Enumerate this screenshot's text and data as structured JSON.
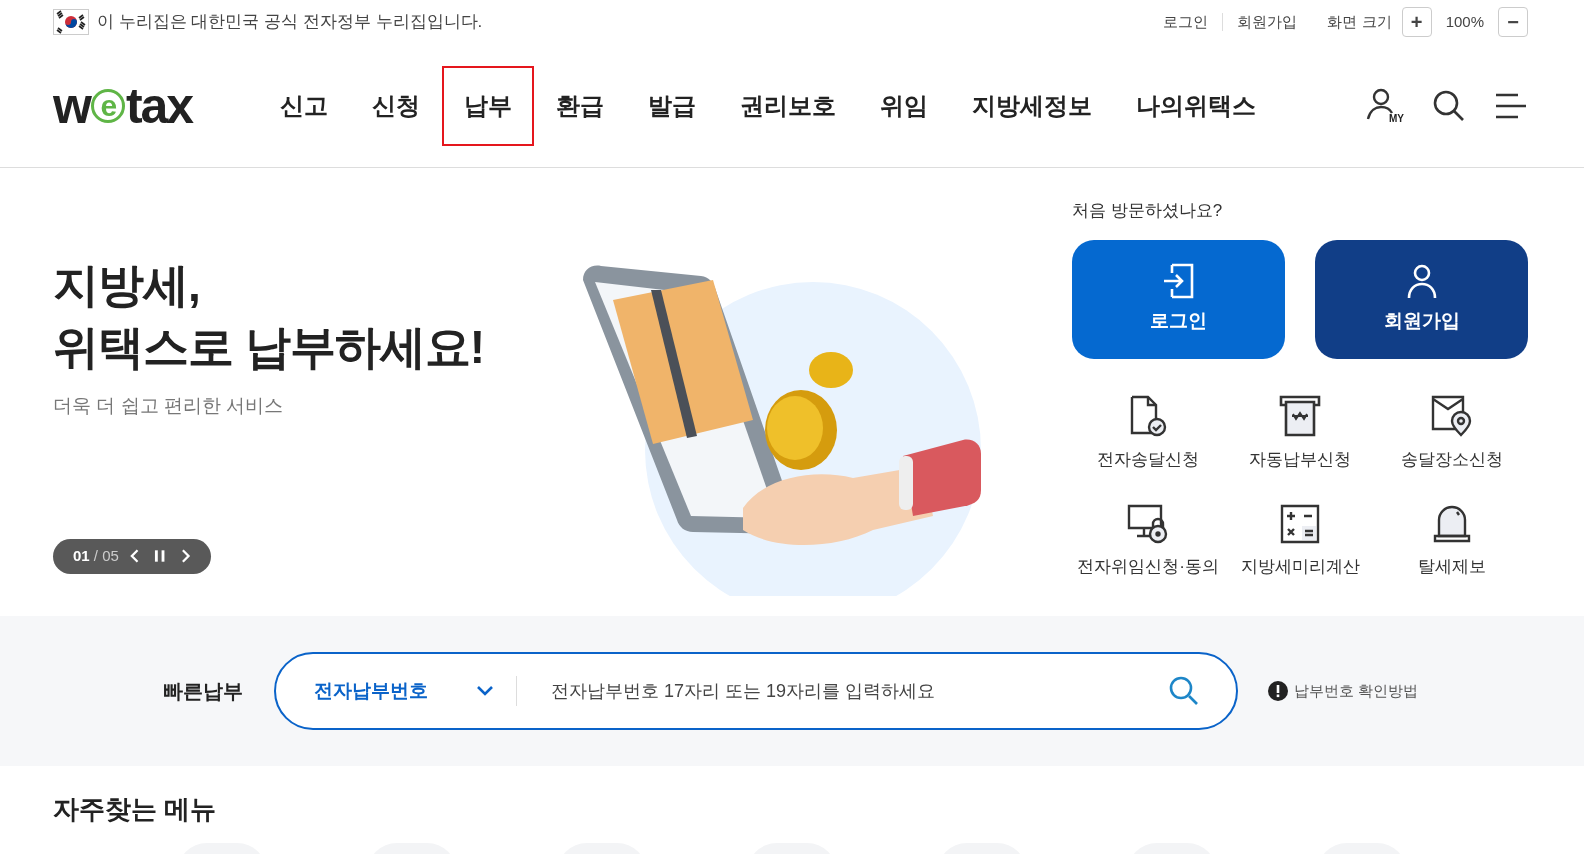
{
  "top_bar": {
    "notice": "이 누리집은 대한민국 공식 전자정부 누리집입니다.",
    "links": [
      "로그인",
      "회원가입"
    ],
    "zoom_label": "화면 크기",
    "zoom_in": "+",
    "zoom_value": "100%",
    "zoom_out": "−"
  },
  "header": {
    "logo": "wetax",
    "nav": [
      {
        "label": "신고",
        "selected": false
      },
      {
        "label": "신청",
        "selected": false
      },
      {
        "label": "납부",
        "selected": true
      },
      {
        "label": "환급",
        "selected": false
      },
      {
        "label": "발급",
        "selected": false
      },
      {
        "label": "권리보호",
        "selected": false
      },
      {
        "label": "위임",
        "selected": false
      },
      {
        "label": "지방세정보",
        "selected": false
      },
      {
        "label": "나의위택스",
        "selected": false
      }
    ],
    "my_badge": "MY"
  },
  "hero": {
    "title_lines": [
      "지방세,",
      "위택스로 납부하세요!"
    ],
    "subtitle": "더욱 더 쉽고 편리한 서비스",
    "slider": {
      "current": "01",
      "separator": "/",
      "total": "05"
    }
  },
  "welcome": {
    "question": "처음 방문하셨나요?",
    "buttons": [
      {
        "label": "로그인",
        "kind": "login"
      },
      {
        "label": "회원가입",
        "kind": "join"
      }
    ],
    "shortcuts": [
      {
        "label": "전자송달신청",
        "kind": "doc"
      },
      {
        "label": "자동납부신청",
        "kind": "atm"
      },
      {
        "label": "송달장소신청",
        "kind": "place"
      },
      {
        "label": "전자위임신청·동의",
        "kind": "monitor"
      },
      {
        "label": "지방세미리계산",
        "kind": "calc"
      },
      {
        "label": "탈세제보",
        "kind": "siren"
      }
    ]
  },
  "quick_pay": {
    "label": "빠른납부",
    "select": "전자납부번호",
    "placeholder": "전자납부번호 17자리 또는 19자리를 입력하세요",
    "help": "납부번호 확인방법"
  },
  "frequent_menu": {
    "title": "자주찾는 메뉴"
  }
}
